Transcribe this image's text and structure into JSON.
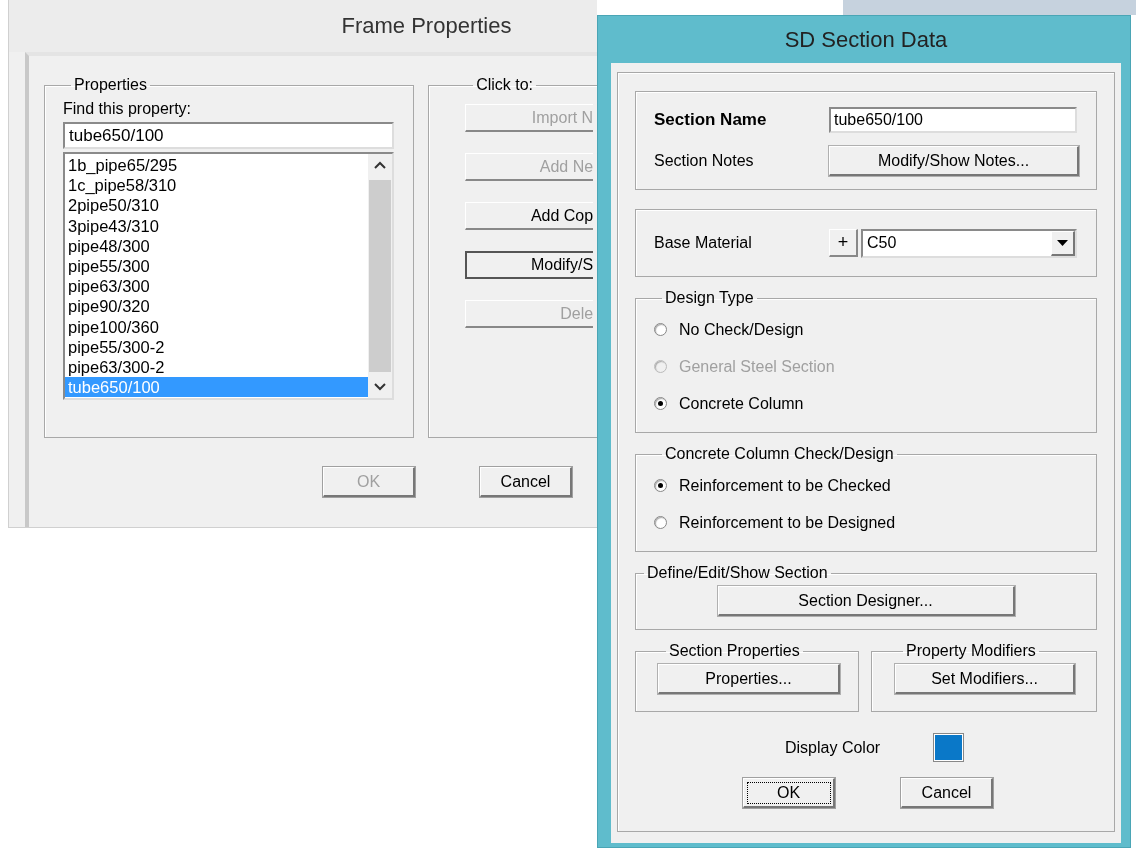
{
  "frame_properties": {
    "title": "Frame Properties",
    "properties_group": {
      "label": "Properties",
      "find_label": "Find this property:",
      "find_value": "tube650/100",
      "items": [
        {
          "label": "1b_pipe65/295",
          "selected": false
        },
        {
          "label": "1c_pipe58/310",
          "selected": false
        },
        {
          "label": "2pipe50/310",
          "selected": false
        },
        {
          "label": "3pipe43/310",
          "selected": false
        },
        {
          "label": "pipe48/300",
          "selected": false
        },
        {
          "label": "pipe55/300",
          "selected": false
        },
        {
          "label": "pipe63/300",
          "selected": false
        },
        {
          "label": "pipe90/320",
          "selected": false
        },
        {
          "label": "pipe100/360",
          "selected": false
        },
        {
          "label": "pipe55/300-2",
          "selected": false
        },
        {
          "label": "pipe63/300-2",
          "selected": false
        },
        {
          "label": "tube650/100",
          "selected": true
        }
      ]
    },
    "click_to": {
      "label": "Click to:",
      "buttons": [
        {
          "label": "Import N",
          "disabled": true,
          "default": false
        },
        {
          "label": "Add Ne",
          "disabled": true,
          "default": false
        },
        {
          "label": "Add Cop",
          "disabled": false,
          "default": false
        },
        {
          "label": "Modify/S",
          "disabled": false,
          "default": true
        },
        {
          "label": "Dele",
          "disabled": true,
          "default": false
        }
      ]
    },
    "buttons": [
      {
        "label": "OK",
        "disabled": true
      },
      {
        "label": "Cancel",
        "disabled": false
      }
    ]
  },
  "section_data": {
    "title": "SD Section Data",
    "section_name_label": "Section Name",
    "section_name_value": "tube650/100",
    "section_notes_label": "Section Notes",
    "notes_button": "Modify/Show Notes...",
    "base_material_label": "Base Material",
    "plus_button": "+",
    "material_value": "C50",
    "design_type": {
      "label": "Design Type",
      "options": [
        {
          "label": "No Check/Design",
          "selected": false,
          "disabled": false
        },
        {
          "label": "General Steel Section",
          "selected": false,
          "disabled": true
        },
        {
          "label": "Concrete Column",
          "selected": true,
          "disabled": false
        }
      ]
    },
    "check_design": {
      "label": "Concrete Column Check/Design",
      "options": [
        {
          "label": "Reinforcement to be Checked",
          "selected": true,
          "disabled": false
        },
        {
          "label": "Reinforcement to be Designed",
          "selected": false,
          "disabled": false
        }
      ]
    },
    "define_section": {
      "label": "Define/Edit/Show Section",
      "button": "Section Designer..."
    },
    "section_properties": {
      "label": "Section Properties",
      "button": "Properties..."
    },
    "property_modifiers": {
      "label": "Property Modifiers",
      "button": "Set Modifiers..."
    },
    "display_color": {
      "label": "Display Color",
      "color": "#0a78c8"
    },
    "buttons": [
      {
        "label": "OK",
        "focused": true
      },
      {
        "label": "Cancel",
        "focused": false
      }
    ]
  }
}
